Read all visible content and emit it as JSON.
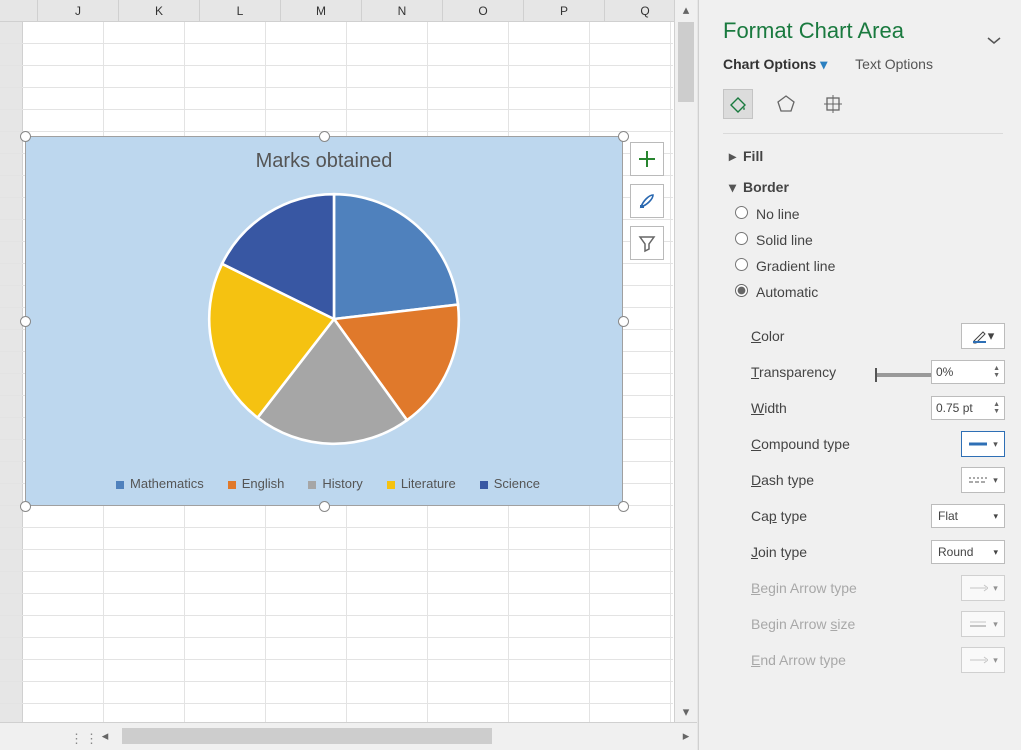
{
  "columns": [
    "J",
    "K",
    "L",
    "M",
    "N",
    "O",
    "P",
    "Q"
  ],
  "chart_data": {
    "type": "pie",
    "title": "Marks obtained",
    "series": [
      {
        "name": "Mathematics",
        "value": 85,
        "color": "#4f81bd"
      },
      {
        "name": "English",
        "value": 62,
        "color": "#e0792b"
      },
      {
        "name": "History",
        "value": 75,
        "color": "#a6a6a6"
      },
      {
        "name": "Literature",
        "value": 80,
        "color": "#f5c211"
      },
      {
        "name": "Science",
        "value": 65,
        "color": "#3857a3"
      }
    ]
  },
  "chart_buttons": {
    "add": "+",
    "brush": "brush",
    "filter": "filter"
  },
  "panel": {
    "title": "Format Chart Area",
    "options_tab": "Chart Options",
    "text_tab": "Text Options",
    "sections": {
      "fill": "Fill",
      "border": "Border"
    },
    "radios": {
      "noline": "No line",
      "solid": "Solid line",
      "gradient": "Gradient line",
      "auto": "Automatic"
    },
    "props": {
      "color": "Color",
      "transparency": "Transparency",
      "transparency_val": "0%",
      "width": "Width",
      "width_val": "0.75 pt",
      "compound": "Compound type",
      "dash": "Dash type",
      "cap": "Cap type",
      "cap_val": "Flat",
      "join": "Join type",
      "join_val": "Round",
      "begin_arrow_type": "Begin Arrow type",
      "begin_arrow_size": "Begin Arrow size",
      "end_arrow_type": "End Arrow type"
    }
  }
}
